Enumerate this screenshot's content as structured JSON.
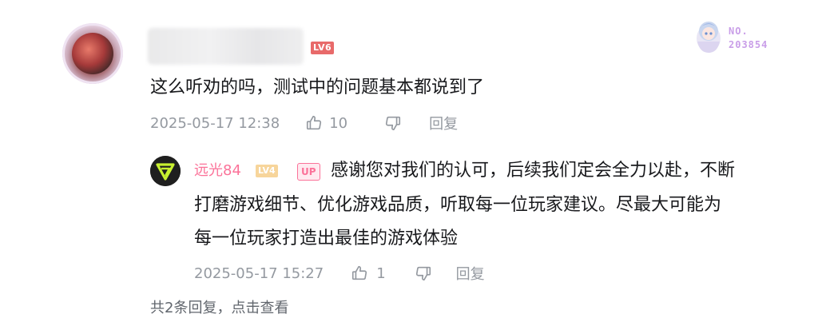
{
  "comment": {
    "user_level": "LV6",
    "text": "这么听劝的吗，测试中的问题基本都说到了",
    "timestamp": "2025-05-17 12:38",
    "like_count": "10",
    "reply_label": "回复"
  },
  "fan_badge": {
    "number": "NO.\n203854"
  },
  "reply": {
    "username": "远光84",
    "user_level": "LV4",
    "up_label": "UP",
    "text_line1": "感谢您对我们的认可，后续我们定会全力以赴，不断",
    "text_line2": "打磨游戏细节、优化游戏品质，听取每一位玩家建议。尽最大可能为",
    "text_line3": "每一位玩家打造出最佳的游戏体验",
    "timestamp": "2025-05-17 15:27",
    "like_count": "1",
    "reply_label": "回复"
  },
  "replies_footer": {
    "text": "共2条回复，点击查看"
  },
  "colors": {
    "accent_pink": "#fb7299",
    "meta_gray": "#9499a0",
    "lv6": "#e86a6a",
    "lv4": "#f7d59b",
    "badge_purple": "#c99ee8"
  }
}
